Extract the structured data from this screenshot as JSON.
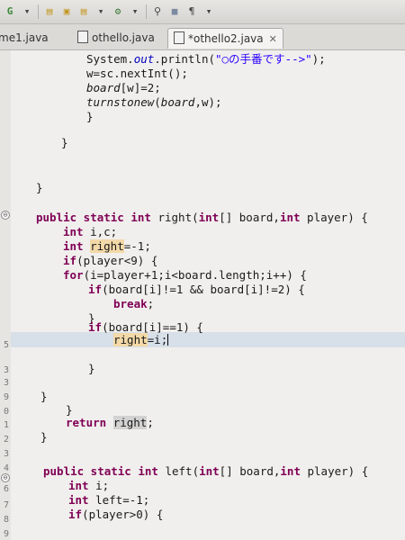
{
  "tabs": [
    {
      "label": "me1.java"
    },
    {
      "label": "othello.java"
    },
    {
      "label": "*othello2.java",
      "close": "✕"
    }
  ],
  "toolbar": {
    "glyphs": [
      "G",
      "▾",
      "▤",
      "▣",
      "▤",
      "▾",
      "⚙",
      "▾",
      "⚲",
      "■",
      "¶",
      "▾"
    ]
  },
  "code": {
    "l1": {
      "a": "System.",
      "b": "out",
      "c": ".println(",
      "d": "\"○の手番です-->\"",
      "e": ");"
    },
    "l2": "w=sc.nextInt();",
    "l3": {
      "a": "board",
      "b": "[w]=2;"
    },
    "l4": {
      "a": "turnstonew",
      "b": "(",
      "c": "board",
      "d": ",w);"
    },
    "l5": "}",
    "l6": "}",
    "l7": "}",
    "l8": {
      "a": "public static int",
      "b": " right(",
      "c": "int",
      "d": "[] board,",
      "e": "int",
      "f": " player) {"
    },
    "l9": {
      "a": "int",
      "b": " i,c;"
    },
    "l10": {
      "a": "int",
      "b": " ",
      "c": "right",
      "d": "=-1;"
    },
    "l11": {
      "a": "if",
      "b": "(player<9) {"
    },
    "l12": {
      "a": "for",
      "b": "(i=player+1;i<board.length;i++) {"
    },
    "l13": {
      "a": "if",
      "b": "(board[i]!=1 && board[i]!=2) {"
    },
    "l14": {
      "a": "break",
      "b": ";"
    },
    "l15": "}",
    "l16": {
      "a": "if",
      "b": "(board[i]==1) {"
    },
    "l17": {
      "a": "right",
      "b": "=i;"
    },
    "l18": "}",
    "l19": "}",
    "l20": "}",
    "l21": {
      "a": "return",
      "b": " ",
      "c": "right",
      "d": ";"
    },
    "l22": "}",
    "l23": {
      "a": "public static int",
      "b": " left(",
      "c": "int",
      "d": "[] board,",
      "e": "int",
      "f": " player) {"
    },
    "l24": {
      "a": "int",
      "b": " i;"
    },
    "l25": {
      "a": "int",
      "b": " left=-1;"
    },
    "l26": {
      "a": "if",
      "b": "(player>0) {"
    }
  },
  "gutter": {
    "nums": [
      "5",
      "3",
      "3",
      "9",
      "0",
      "1",
      "2",
      "3",
      "4",
      "5",
      "6",
      "7",
      "8",
      "9"
    ],
    "fold_markers": [
      "⊖",
      "⊖"
    ]
  },
  "colors": {
    "keyword": "#7f0055",
    "string": "#2a00ff",
    "occurrence": "#f3d9a8",
    "current_line": "#d7dfe8"
  }
}
